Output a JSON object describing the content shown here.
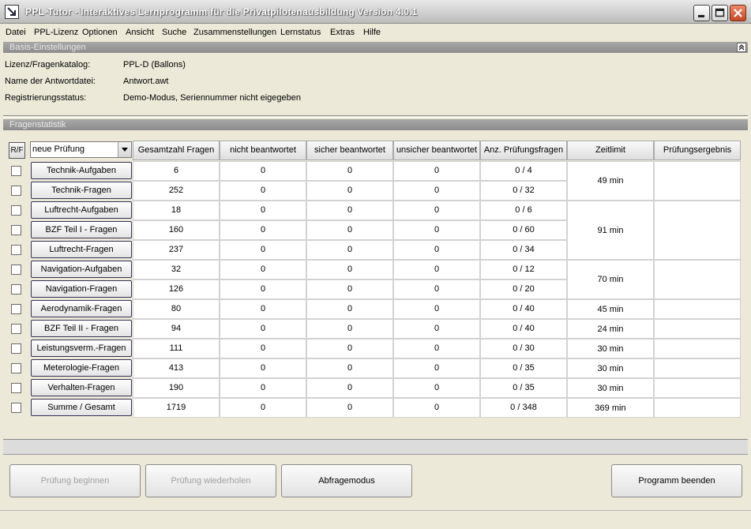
{
  "window": {
    "title": "PPL-Tutor - Interaktives Lernprogramm für die Privatpilotenausbildung Version 4.0.1"
  },
  "menu": [
    "Datei",
    "PPL-Lizenz",
    "Optionen",
    "Ansicht",
    "Suche",
    "Zusammenstellungen",
    "Lernstatus",
    "Extras",
    "Hilfe"
  ],
  "basis": {
    "header": "Basis-Einstellungen",
    "rows": [
      {
        "label": "Lizenz/Fragenkatalog:",
        "value": "PPL-D (Ballons)"
      },
      {
        "label": "Name der Antwortdatei:",
        "value": "Antwort.awt"
      },
      {
        "label": "Registrierungsstatus:",
        "value": "Demo-Modus, Seriennummer nicht eigegeben"
      }
    ]
  },
  "stats": {
    "header": "Fragenstatistik",
    "rf_label": "R/F",
    "combo_value": "neue Prüfung",
    "columns": [
      "Gesamtzahl Fragen",
      "nicht beantwortet",
      "sicher beantwortet",
      "unsicher beantwortet",
      "Anz. Prüfungsfragen",
      "Zeitlimit",
      "Prüfungsergebnis"
    ],
    "rows": [
      {
        "name": "Technik-Aufgaben",
        "total": "6",
        "nicht": "0",
        "sicher": "0",
        "unsicher": "0",
        "pruef": "0 / 4"
      },
      {
        "name": "Technik-Fragen",
        "total": "252",
        "nicht": "0",
        "sicher": "0",
        "unsicher": "0",
        "pruef": "0 / 32"
      },
      {
        "name": "Luftrecht-Aufgaben",
        "total": "18",
        "nicht": "0",
        "sicher": "0",
        "unsicher": "0",
        "pruef": "0 / 6"
      },
      {
        "name": "BZF Teil I - Fragen",
        "total": "160",
        "nicht": "0",
        "sicher": "0",
        "unsicher": "0",
        "pruef": "0 / 60"
      },
      {
        "name": "Luftrecht-Fragen",
        "total": "237",
        "nicht": "0",
        "sicher": "0",
        "unsicher": "0",
        "pruef": "0 / 34"
      },
      {
        "name": "Navigation-Aufgaben",
        "total": "32",
        "nicht": "0",
        "sicher": "0",
        "unsicher": "0",
        "pruef": "0 / 12"
      },
      {
        "name": "Navigation-Fragen",
        "total": "126",
        "nicht": "0",
        "sicher": "0",
        "unsicher": "0",
        "pruef": "0 / 20"
      },
      {
        "name": "Aerodynamik-Fragen",
        "total": "80",
        "nicht": "0",
        "sicher": "0",
        "unsicher": "0",
        "pruef": "0 / 40"
      },
      {
        "name": "BZF Teil II - Fragen",
        "total": "94",
        "nicht": "0",
        "sicher": "0",
        "unsicher": "0",
        "pruef": "0 / 40"
      },
      {
        "name": "Leistungsverm.-Fragen",
        "total": "111",
        "nicht": "0",
        "sicher": "0",
        "unsicher": "0",
        "pruef": "0 / 30"
      },
      {
        "name": "Meterologie-Fragen",
        "total": "413",
        "nicht": "0",
        "sicher": "0",
        "unsicher": "0",
        "pruef": "0 / 35"
      },
      {
        "name": "Verhalten-Fragen",
        "total": "190",
        "nicht": "0",
        "sicher": "0",
        "unsicher": "0",
        "pruef": "0 / 35"
      },
      {
        "name": "Summe / Gesamt",
        "total": "1719",
        "nicht": "0",
        "sicher": "0",
        "unsicher": "0",
        "pruef": "0 / 348"
      }
    ],
    "zeitlimit": [
      {
        "value": "49 min"
      },
      {
        "value": "91 min"
      },
      {
        "value": "70 min"
      },
      {
        "value": "45 min"
      },
      {
        "value": "24 min"
      },
      {
        "value": "30 min"
      },
      {
        "value": "30 min"
      },
      {
        "value": "30 min"
      },
      {
        "value": "369 min"
      }
    ]
  },
  "buttons": {
    "start": "Prüfung beginnen",
    "repeat": "Prüfung wiederholen",
    "query": "Abfragemodus",
    "quit": "Programm beenden"
  },
  "colors": {
    "background": "#ece9d8",
    "section_header": "#9a9a9a",
    "close_button": "#d05a36"
  }
}
